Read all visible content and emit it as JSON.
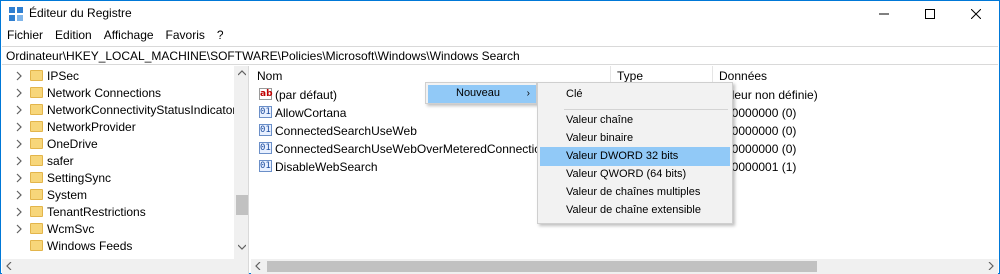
{
  "window": {
    "title": "Éditeur du Registre",
    "accent_color": "#0078d7"
  },
  "menubar": {
    "items": [
      "Fichier",
      "Edition",
      "Affichage",
      "Favoris",
      "?"
    ]
  },
  "address": {
    "path": "Ordinateur\\HKEY_LOCAL_MACHINE\\SOFTWARE\\Policies\\Microsoft\\Windows\\Windows Search"
  },
  "tree": {
    "items": [
      {
        "label": "IPSec",
        "icon": "folder-icon"
      },
      {
        "label": "Network Connections",
        "icon": "folder-icon"
      },
      {
        "label": "NetworkConnectivityStatusIndicator",
        "icon": "folder-icon"
      },
      {
        "label": "NetworkProvider",
        "icon": "folder-icon"
      },
      {
        "label": "OneDrive",
        "icon": "folder-icon"
      },
      {
        "label": "safer",
        "icon": "folder-icon"
      },
      {
        "label": "SettingSync",
        "icon": "folder-icon"
      },
      {
        "label": "System",
        "icon": "folder-icon"
      },
      {
        "label": "TenantRestrictions",
        "icon": "folder-icon"
      },
      {
        "label": "WcmSvc",
        "icon": "folder-icon"
      },
      {
        "label": "Windows Feeds",
        "icon": "folder-icon"
      }
    ]
  },
  "list": {
    "columns": [
      "Nom",
      "Type",
      "Données"
    ],
    "rows": [
      {
        "name": "(par défaut)",
        "icon": "string-value-icon",
        "data": "aleur non définie)"
      },
      {
        "name": "AllowCortana",
        "icon": "binary-value-icon",
        "data": "00000000 (0)"
      },
      {
        "name": "ConnectedSearchUseWeb",
        "icon": "binary-value-icon",
        "data": "00000000 (0)"
      },
      {
        "name": "ConnectedSearchUseWebOverMeteredConnections",
        "icon": "binary-value-icon",
        "data": "00000000 (0)"
      },
      {
        "name": "DisableWebSearch",
        "icon": "binary-value-icon",
        "data": "00000001 (1)"
      }
    ]
  },
  "context_menu": {
    "nouveau_label": "Nouveau",
    "submenu": {
      "items": [
        "Clé",
        "Valeur chaîne",
        "Valeur binaire",
        "Valeur DWORD 32 bits",
        "Valeur QWORD (64 bits)",
        "Valeur de chaînes multiples",
        "Valeur de chaîne extensible"
      ],
      "highlighted": "Valeur DWORD 32 bits"
    },
    "highlight_color": "#91c9f7"
  }
}
